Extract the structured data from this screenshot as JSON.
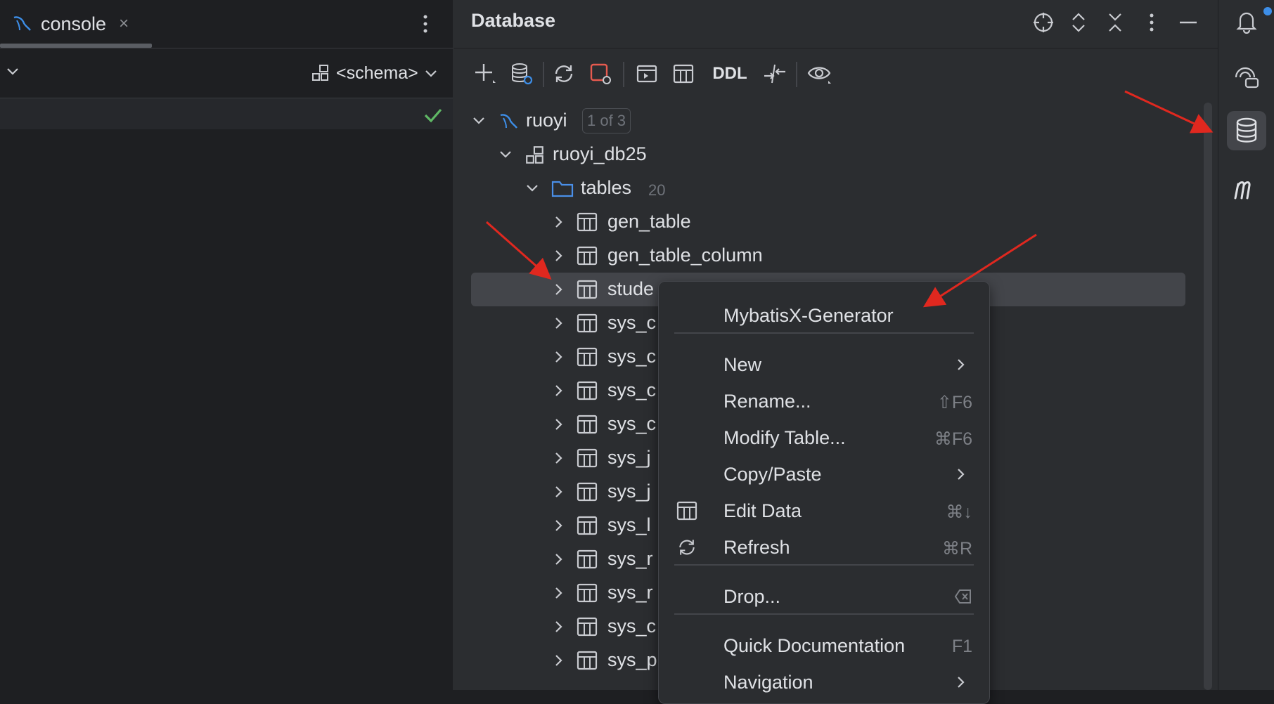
{
  "left": {
    "tab_label": "console",
    "tab_close": "×",
    "schema_label": "<schema>"
  },
  "database": {
    "title": "Database",
    "toolbar": {
      "ddl_label": "DDL"
    },
    "tree": {
      "connection": {
        "name": "ruoyi",
        "badge": "1 of 3"
      },
      "schema": {
        "name": "ruoyi_db25"
      },
      "folder": {
        "name": "tables",
        "count": "20"
      },
      "tables": [
        "gen_table",
        "gen_table_column",
        "stude",
        "sys_c",
        "sys_c",
        "sys_c",
        "sys_c",
        "sys_j",
        "sys_j",
        "sys_l",
        "sys_r",
        "sys_r",
        "sys_c",
        "sys_p"
      ]
    }
  },
  "context_menu": {
    "items": [
      {
        "label": "MybatisX-Generator"
      },
      {
        "label": "New",
        "submenu": true
      },
      {
        "label": "Rename...",
        "shortcut": "⇧F6"
      },
      {
        "label": "Modify Table...",
        "shortcut": "⌘F6"
      },
      {
        "label": "Copy/Paste",
        "submenu": true
      },
      {
        "label": "Edit Data",
        "shortcut": "⌘↓",
        "icon": "table-icon"
      },
      {
        "label": "Refresh",
        "shortcut": "⌘R",
        "icon": "refresh-icon"
      },
      {
        "label": "Drop...",
        "shortcut_icon": "delete-key-icon"
      },
      {
        "label": "Quick Documentation",
        "shortcut": "F1"
      },
      {
        "label": "Navigation",
        "submenu": true
      }
    ]
  },
  "colors": {
    "background": "#1e1f22",
    "panel": "#2b2d30",
    "selection": "#43454a",
    "accent_blue": "#3d8ee8",
    "annotation_red": "#e0281f",
    "success_green": "#5fb865"
  }
}
